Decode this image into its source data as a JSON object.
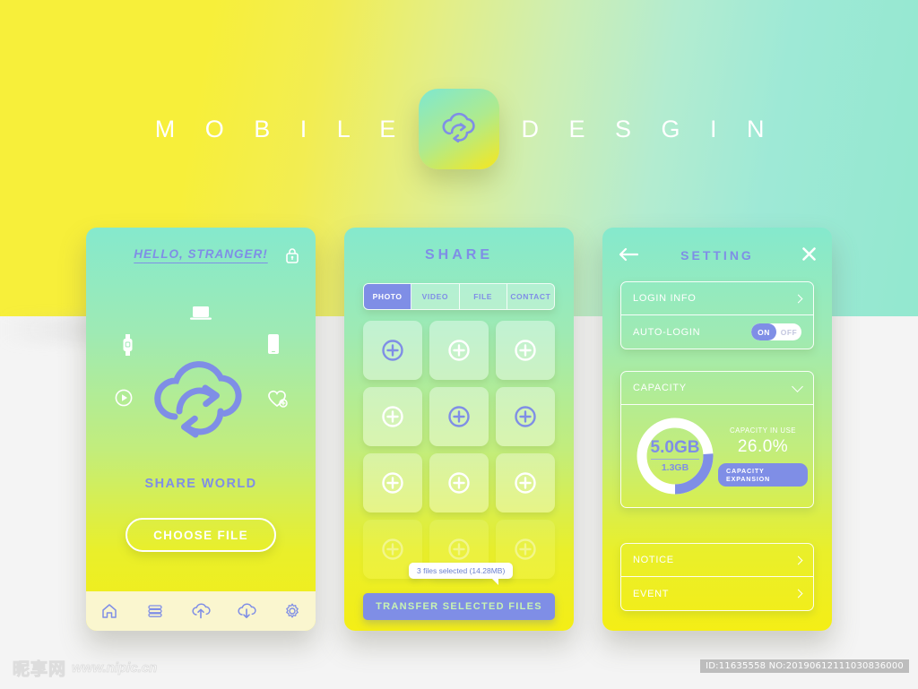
{
  "header": {
    "word_left": "M O B I L E",
    "word_right": "D E S G I N",
    "app_icon": "cloud-sync-icon"
  },
  "colors": {
    "accent_blue": "#7f8ee6",
    "yellow": "#f7ef3a",
    "mint": "#93e8cf",
    "white": "#ffffff",
    "nav_bar": "#faf6cf"
  },
  "screen1": {
    "greeting": "HELLO, STRANGER!",
    "lock_icon": "lock-icon",
    "devices": [
      {
        "name": "laptop-icon"
      },
      {
        "name": "watch-icon"
      },
      {
        "name": "smartphone-icon"
      },
      {
        "name": "play-circle-icon"
      },
      {
        "name": "heart-plus-icon"
      }
    ],
    "cloud_icon": "cloud-sync-icon",
    "subtitle": "SHARE WORLD",
    "button": "CHOOSE FILE",
    "nav": [
      {
        "label": "home",
        "icon": "home-icon"
      },
      {
        "label": "list",
        "icon": "list-stack-icon"
      },
      {
        "label": "upload",
        "icon": "cloud-upload-icon"
      },
      {
        "label": "download",
        "icon": "cloud-download-icon"
      },
      {
        "label": "settings",
        "icon": "gear-icon"
      }
    ]
  },
  "screen2": {
    "title": "SHARE",
    "tabs": [
      {
        "label": "PHOTO",
        "active": true
      },
      {
        "label": "VIDEO",
        "active": false
      },
      {
        "label": "FILE",
        "active": false
      },
      {
        "label": "CONTACT",
        "active": false
      }
    ],
    "tiles": [
      {
        "row": 1,
        "selected": true
      },
      {
        "row": 1,
        "selected": false
      },
      {
        "row": 1,
        "selected": false
      },
      {
        "row": 2,
        "selected": false
      },
      {
        "row": 2,
        "selected": true
      },
      {
        "row": 2,
        "selected": true
      },
      {
        "row": 3,
        "selected": false
      },
      {
        "row": 3,
        "selected": false
      },
      {
        "row": 3,
        "selected": false
      },
      {
        "row": 4,
        "selected": false
      },
      {
        "row": 4,
        "selected": false
      },
      {
        "row": 4,
        "selected": false
      }
    ],
    "tile_icon": "plus-circle-icon",
    "tooltip": "3 files selected (14.28MB)",
    "transfer_button": "TRANSFER SELECTED FILES"
  },
  "screen3": {
    "title": "SETTING",
    "back_icon": "arrow-left-icon",
    "close_icon": "close-icon",
    "login_info": {
      "label": "LOGIN INFO",
      "chevron": "chevron-right-icon"
    },
    "auto_login": {
      "label": "AUTO-LOGIN",
      "on": "ON",
      "off": "OFF",
      "state": "ON"
    },
    "capacity": {
      "label": "CAPACITY",
      "chevron": "chevron-down-icon",
      "total": "5.0GB",
      "used": "1.3GB",
      "in_use_label": "CAPACITY IN USE",
      "in_use_percent": "26.0%",
      "expand_button": "CAPACITY EXPANSION"
    },
    "notice": {
      "label": "NOTICE",
      "chevron": "chevron-right-icon"
    },
    "event": {
      "label": "EVENT",
      "chevron": "chevron-right-icon"
    }
  },
  "watermark": {
    "site_cn": "昵享网",
    "site_url": "www.nipic.cn",
    "id_text": "ID:11635558 NO:20190612111030836000"
  },
  "chart_data": {
    "type": "pie",
    "title": "CAPACITY IN USE",
    "categories": [
      "Used",
      "Free"
    ],
    "values": [
      26.0,
      74.0
    ],
    "unit": "%",
    "total_label": "5.0GB",
    "used_label": "1.3GB",
    "colors": [
      "#7f8ee6",
      "#ffffff"
    ],
    "legend": "none",
    "donut": true,
    "inner_radius_ratio": 0.66,
    "start_angle_deg": 0,
    "direction": "counterclockwise"
  }
}
